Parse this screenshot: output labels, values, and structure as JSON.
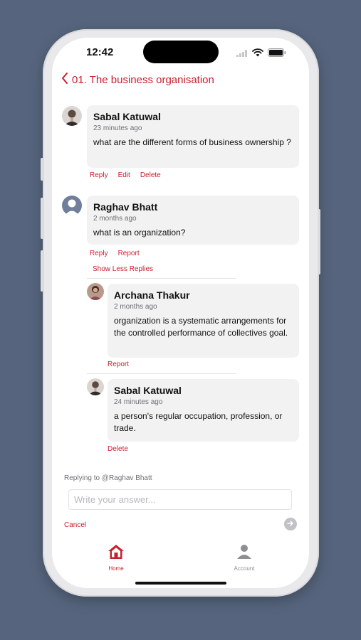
{
  "status_bar": {
    "time": "12:42"
  },
  "nav": {
    "title": "01. The business organisation"
  },
  "comments": [
    {
      "author": "Sabal Katuwal",
      "time_ago": "23 minutes ago",
      "text": "what are the different forms of business ownership ?",
      "actions": [
        "Reply",
        "Edit",
        "Delete"
      ]
    },
    {
      "author": "Raghav Bhatt",
      "time_ago": "2 months ago",
      "text": "what is an organization?",
      "actions": [
        "Reply",
        "Report"
      ],
      "toggle_label": "Show Less Replies",
      "replies": [
        {
          "author": "Archana Thakur",
          "time_ago": "2 months ago",
          "text": "organization is a systematic arrangements for the controlled performance of collectives goal.",
          "actions": [
            "Report"
          ]
        },
        {
          "author": "Sabal Katuwal",
          "time_ago": "24 minutes ago",
          "text": "a person's regular occupation, profession, or trade.",
          "actions": [
            "Delete"
          ]
        }
      ]
    }
  ],
  "reply_box": {
    "replying_to": "Replying to @Raghav Bhatt",
    "placeholder": "Write your answer...",
    "cancel_label": "Cancel"
  },
  "tabs": [
    {
      "label": "Home",
      "icon": "home-icon",
      "active": true
    },
    {
      "label": "Account",
      "icon": "person-icon",
      "active": false
    }
  ],
  "colors": {
    "accent": "#c8202c",
    "background": "#56657d",
    "bubble": "#f2f2f3",
    "inactive": "#8e8e93"
  }
}
